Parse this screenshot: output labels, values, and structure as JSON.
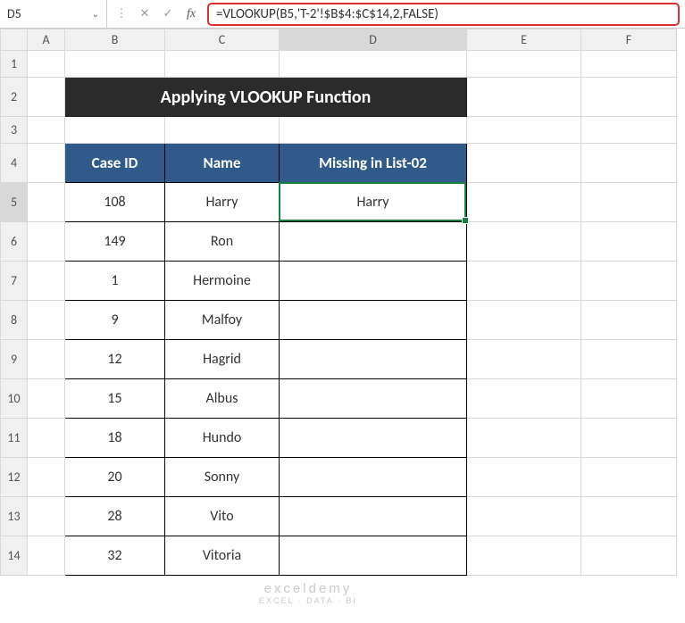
{
  "nameBox": "D5",
  "formula": "=VLOOKUP(B5,'T-2'!$B$4:$C$14,2,FALSE)",
  "columns": [
    "A",
    "B",
    "C",
    "D",
    "E",
    "F"
  ],
  "rows": [
    "1",
    "2",
    "3",
    "4",
    "5",
    "6",
    "7",
    "8",
    "9",
    "10",
    "11",
    "12",
    "13",
    "14"
  ],
  "title": "Applying VLOOKUP Function",
  "headers": {
    "caseId": "Case ID",
    "name": "Name",
    "missing": "Missing in List-02"
  },
  "data": [
    {
      "id": "108",
      "name": "Harry",
      "missing": "Harry"
    },
    {
      "id": "149",
      "name": "Ron",
      "missing": ""
    },
    {
      "id": "1",
      "name": "Hermoine",
      "missing": ""
    },
    {
      "id": "9",
      "name": "Malfoy",
      "missing": ""
    },
    {
      "id": "12",
      "name": "Hagrid",
      "missing": ""
    },
    {
      "id": "15",
      "name": "Albus",
      "missing": ""
    },
    {
      "id": "18",
      "name": "Hundo",
      "missing": ""
    },
    {
      "id": "20",
      "name": "Sonny",
      "missing": ""
    },
    {
      "id": "28",
      "name": "Vito",
      "missing": ""
    },
    {
      "id": "32",
      "name": "Vitoria",
      "missing": ""
    }
  ],
  "watermark": {
    "top": "exceldemy",
    "bot": "EXCEL · DATA · BI"
  },
  "activeCell": {
    "col": "D",
    "row": 5
  }
}
